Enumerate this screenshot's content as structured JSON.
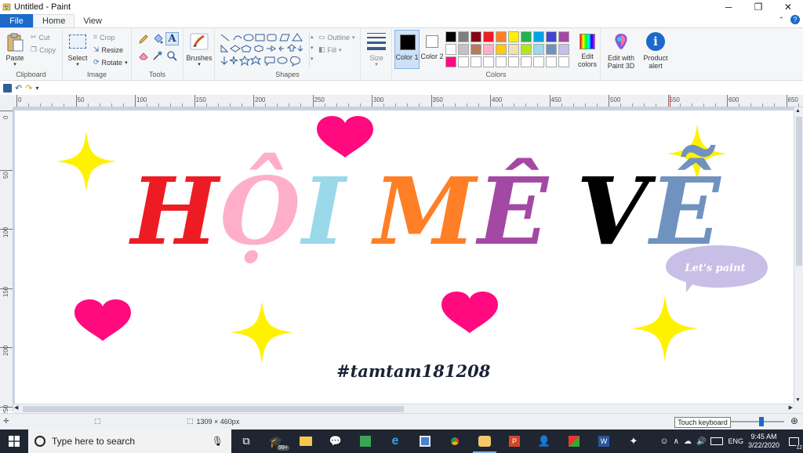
{
  "window": {
    "title": "Untitled - Paint",
    "controls": [
      "minimize",
      "maximize",
      "close"
    ]
  },
  "tabs": [
    {
      "label": "File"
    },
    {
      "label": "Home"
    },
    {
      "label": "View"
    }
  ],
  "ribbon": {
    "clipboard": {
      "label": "Clipboard",
      "paste": "Paste",
      "cut": "Cut",
      "copy": "Copy"
    },
    "image": {
      "label": "Image",
      "select": "Select",
      "crop": "Crop",
      "resize": "Resize",
      "rotate": "Rotate"
    },
    "tools": {
      "label": "Tools"
    },
    "brushes": {
      "label": "Brushes"
    },
    "shapes": {
      "label": "Shapes",
      "outline": "Outline",
      "fill": "Fill"
    },
    "size": {
      "label": "Size"
    },
    "colors": {
      "label": "Colors",
      "color1": "Color 1",
      "color2": "Color 2",
      "color1_value": "#000000",
      "color2_value": "#ffffff",
      "palette_row1": [
        "#000000",
        "#7f7f7f",
        "#880015",
        "#ed1c24",
        "#ff7f27",
        "#fff200",
        "#22b14c",
        "#00a2e8",
        "#3f48cc",
        "#a349a4"
      ],
      "palette_row2": [
        "#ffffff",
        "#c3c3c3",
        "#b97a57",
        "#ffaec9",
        "#ffc90e",
        "#efe4b0",
        "#b5e61d",
        "#99d9ea",
        "#7092be",
        "#c8bfe7"
      ],
      "palette_row3": [
        "#ff0a7f",
        "#ffffff",
        "#ffffff",
        "#ffffff",
        "#ffffff",
        "#ffffff",
        "#ffffff",
        "#ffffff",
        "#ffffff",
        "#ffffff"
      ],
      "edit_colors": "Edit colors"
    },
    "paint3d": "Edit with Paint 3D",
    "product_alert": "Product alert"
  },
  "ruler": {
    "h_ticks": [
      "0",
      "50",
      "100",
      "150",
      "200",
      "250",
      "300",
      "350",
      "400",
      "450",
      "500",
      "550",
      "600",
      "650"
    ],
    "v_ticks": [
      "0",
      "50",
      "100",
      "150",
      "200",
      "250"
    ]
  },
  "canvas_art": {
    "title_letters": [
      {
        "ch": "H",
        "color": "#ed1c24"
      },
      {
        "ch": "Ộ",
        "color": "#ffaec9"
      },
      {
        "ch": "I",
        "color": "#99d9ea"
      },
      {
        "ch": " ",
        "color": "#000000"
      },
      {
        "ch": "M",
        "color": "#ff7f27"
      },
      {
        "ch": "Ê",
        "color": "#a349a4"
      },
      {
        "ch": " ",
        "color": "#000000"
      },
      {
        "ch": "V",
        "color": "#000000"
      },
      {
        "ch": "Ễ",
        "color": "#7092be"
      }
    ],
    "bubble_text": "Let's paint",
    "hashtag": "#tamtam181208",
    "heart_color": "#ff0a7f",
    "star_color": "#fff200",
    "bubble_color": "#c8bfe7"
  },
  "status": {
    "dimensions": "1309 × 460px",
    "touch_keyboard": "Touch keyboard"
  },
  "taskbar": {
    "search_placeholder": "Type here to search",
    "badge": "99+",
    "lang": "ENG",
    "time": "9:45 AM",
    "date": "3/22/2020",
    "notifications": "12"
  }
}
